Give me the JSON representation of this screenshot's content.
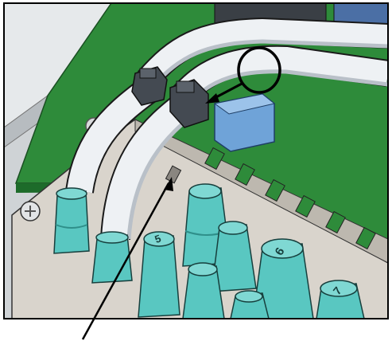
{
  "illustration": {
    "kind": "cable-routing-detail",
    "colors": {
      "pcb": "#2e8b3a",
      "pcb_dark": "#1d6b2a",
      "bracket": "#d9d4cc",
      "bracket_shadow": "#a9a49c",
      "cable": "#eef1f4",
      "cable_shade": "#b9c0c8",
      "grommet": "#59c7c1",
      "grommet_dark": "#2f8f8a",
      "clip": "#444a52",
      "connector": "#6fa3d8",
      "outline": "#111111",
      "frame": "#000000",
      "enclosure": "#cfd3d6"
    },
    "grommet_labels": [
      "5",
      "6",
      "7"
    ],
    "callouts": [
      {
        "name": "clip-callout-circle",
        "shape": "circle"
      },
      {
        "name": "clip-callout-arrow",
        "shape": "arrow"
      },
      {
        "name": "grommet-leader-line",
        "shape": "line"
      }
    ]
  }
}
